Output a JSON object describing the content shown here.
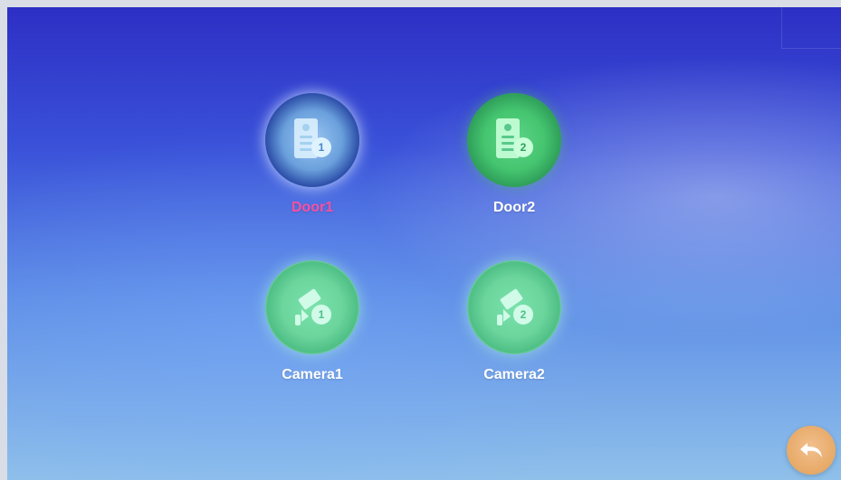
{
  "tiles": [
    {
      "id": "door1",
      "label": "Door1",
      "kind": "door",
      "state": "selected",
      "number": "1"
    },
    {
      "id": "door2",
      "label": "Door2",
      "kind": "door",
      "state": "normal",
      "number": "2"
    },
    {
      "id": "camera1",
      "label": "Camera1",
      "kind": "camera",
      "state": "normal",
      "number": "1"
    },
    {
      "id": "camera2",
      "label": "Camera2",
      "kind": "camera",
      "state": "normal",
      "number": "2"
    }
  ],
  "back": {
    "icon": "back-arrow-icon"
  }
}
